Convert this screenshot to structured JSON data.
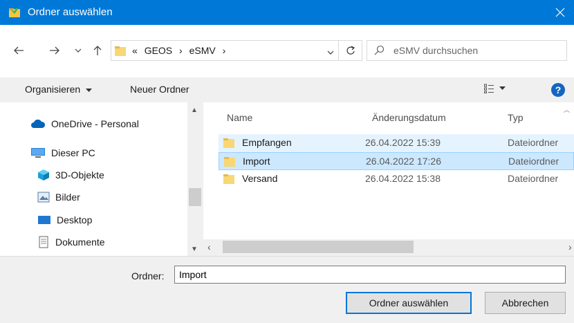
{
  "window": {
    "title": "Ordner auswählen",
    "accent": "#0078d7",
    "icons": {
      "app": "folder-app-icon",
      "close": "close-icon"
    }
  },
  "navigation": {
    "back_icon": "arrow-left-icon",
    "forward_icon": "arrow-right-icon",
    "recent_icon": "chevron-down-icon",
    "up_icon": "arrow-up-icon",
    "breadcrumb": {
      "overflow": "«",
      "items": [
        "GEOS",
        "eSMV"
      ],
      "separator": "›"
    },
    "refresh_icon": "refresh-icon",
    "search_placeholder": "eSMV durchsuchen"
  },
  "command_bar": {
    "organize": "Organisieren",
    "new_folder": "Neuer Ordner",
    "help": "?"
  },
  "nav_pane": {
    "items": [
      {
        "label": "OneDrive - Personal",
        "icon": "cloud-icon"
      },
      {
        "label": "Dieser PC",
        "icon": "computer-icon"
      },
      {
        "label": "3D-Objekte",
        "icon": "cube-icon"
      },
      {
        "label": "Bilder",
        "icon": "pictures-icon"
      },
      {
        "label": "Desktop",
        "icon": "desktop-icon"
      },
      {
        "label": "Dokumente",
        "icon": "document-icon"
      }
    ]
  },
  "file_list": {
    "columns": [
      "Name",
      "Änderungsdatum",
      "Typ"
    ],
    "rows": [
      {
        "name": "Empfangen",
        "date": "26.04.2022 15:39",
        "type": "Dateiordner",
        "state": "hover"
      },
      {
        "name": "Import",
        "date": "26.04.2022 17:26",
        "type": "Dateiordner",
        "state": "selected"
      },
      {
        "name": "Versand",
        "date": "26.04.2022 15:38",
        "type": "Dateiordner",
        "state": "normal"
      }
    ]
  },
  "footer": {
    "folder_label": "Ordner:",
    "folder_value": "Import",
    "select_button": "Ordner auswählen",
    "cancel_button": "Abbrechen"
  }
}
